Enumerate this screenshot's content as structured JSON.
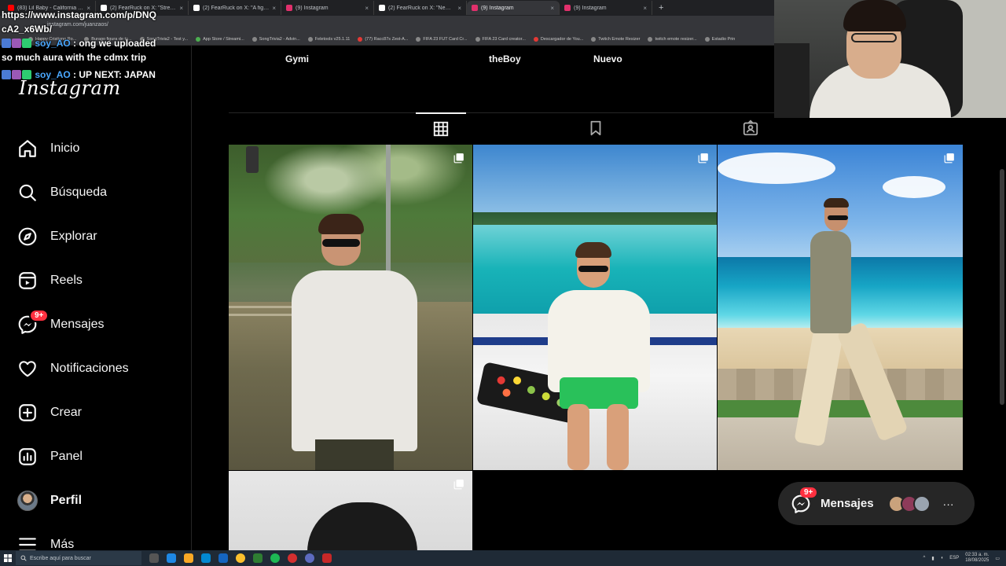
{
  "browser": {
    "tabs": [
      {
        "label": "(83) Lil Baby - California Breeze",
        "color": "#ff0000"
      },
      {
        "label": "(2) FearRuck on X: \"Streamer w",
        "color": "#ffffff"
      },
      {
        "label": "(2) FearRuck on X: \"A fight bre",
        "color": "#ffffff"
      },
      {
        "label": "(9) Instagram",
        "color": "#e1306c"
      },
      {
        "label": "(2) FearRuck on X: \"New photo",
        "color": "#ffffff"
      },
      {
        "label": "(9) Instagram",
        "color": "#e1306c",
        "active": true
      },
      {
        "label": "(9) Instagram",
        "color": "#e1306c"
      }
    ],
    "url": "instagram.com/juanzaos/",
    "bookmarks": [
      "Happy Cristiano Ro...",
      "Burago figura de to...",
      "SongTrivia2 - Test y...",
      "App Store / Streami...",
      "SongTrivia2 - Advin...",
      "Feletools v25.1.11",
      "(77) Racc87s Zest-A...",
      "FIFA 23 FUT Card Cr...",
      "FIFA 23 Card creator...",
      "Descargador de You...",
      "Twitch Emote Resizer",
      "twitch emote resizer...",
      "Estadio Prin"
    ]
  },
  "chat": {
    "line1_partial": "https://www.instagram.com/p/DNQ",
    "line2": "cA2_x6Wb/",
    "msg1_user": "soy_AO",
    "msg1_text": ": ong we uploaded",
    "msg1_cont": "so much aura with the cdmx trip",
    "msg2_user": "soy_AO",
    "msg2_text": ": UP NEXT: JAPAN"
  },
  "sidebar": {
    "logo": "Instagram",
    "items": [
      {
        "label": "Inicio",
        "icon": "home-icon"
      },
      {
        "label": "Búsqueda",
        "icon": "search-icon"
      },
      {
        "label": "Explorar",
        "icon": "compass-icon"
      },
      {
        "label": "Reels",
        "icon": "reels-icon"
      },
      {
        "label": "Mensajes",
        "icon": "messenger-icon",
        "badge": "9+"
      },
      {
        "label": "Notificaciones",
        "icon": "heart-icon"
      },
      {
        "label": "Crear",
        "icon": "plus-icon"
      },
      {
        "label": "Panel",
        "icon": "chart-icon"
      },
      {
        "label": "Perfil",
        "icon": "avatar"
      },
      {
        "label": "Más",
        "icon": "menu-icon"
      }
    ]
  },
  "profile": {
    "highlights": [
      "Gymi",
      "theBoy",
      "Nuevo"
    ],
    "tabs": [
      "posts-grid",
      "saved",
      "tagged"
    ]
  },
  "posts": [
    {
      "type": "carousel",
      "scene": "street"
    },
    {
      "type": "carousel",
      "scene": "boat"
    },
    {
      "type": "carousel",
      "scene": "beach"
    },
    {
      "type": "carousel",
      "scene": "portrait"
    }
  ],
  "messages_pill": {
    "label": "Mensajes",
    "badge": "9+",
    "more": "···"
  },
  "taskbar": {
    "search_placeholder": "Escribe aquí para buscar",
    "lang": "ESP",
    "time": "02:33 a. m.",
    "date": "18/08/2025"
  }
}
